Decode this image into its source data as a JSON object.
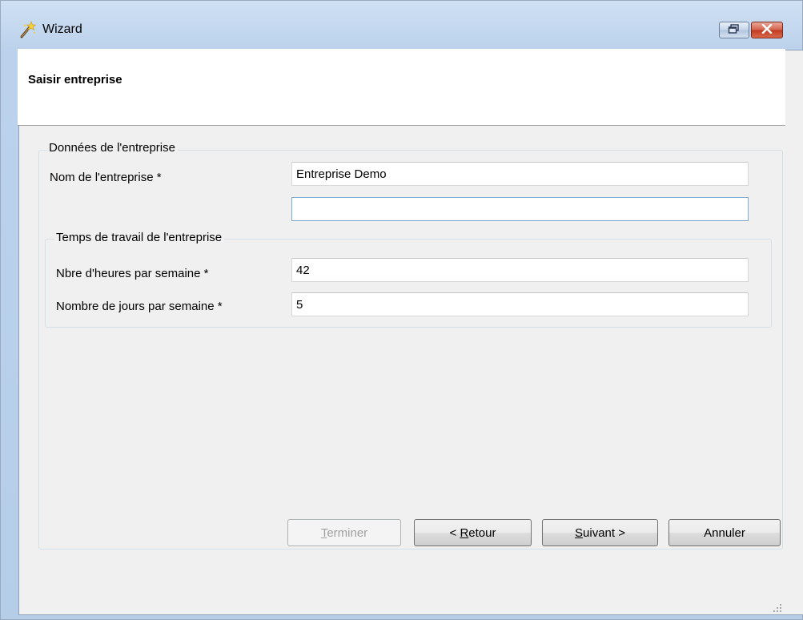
{
  "window": {
    "title": "Wizard",
    "restore_icon": "restore-icon",
    "close_icon": "close-icon"
  },
  "header": {
    "title": "Saisir entreprise"
  },
  "company_group": {
    "label": "Données de l'entreprise",
    "name_label": "Nom de l'entreprise *",
    "name_value": "Entreprise Demo",
    "name_line2_value": ""
  },
  "worktime_group": {
    "label": "Temps de travail de l'entreprise",
    "hours_label": "Nbre d'heures par semaine *",
    "hours_value": "42",
    "days_label": "Nombre de jours par semaine *",
    "days_value": "5"
  },
  "buttons": {
    "finish_pre": "",
    "finish_mnemonic": "T",
    "finish_post": "erminer",
    "back_pre": "< ",
    "back_mnemonic": "R",
    "back_post": "etour",
    "next_pre": "",
    "next_mnemonic": "S",
    "next_post": "uivant >",
    "cancel_label": "Annuler"
  },
  "colors": {
    "titlebar": "#bcd2ec",
    "client_bg": "#f0f0f0",
    "header_bg": "#ffffff",
    "focus_border": "#7ea9d2",
    "close_red": "#c0391f"
  }
}
